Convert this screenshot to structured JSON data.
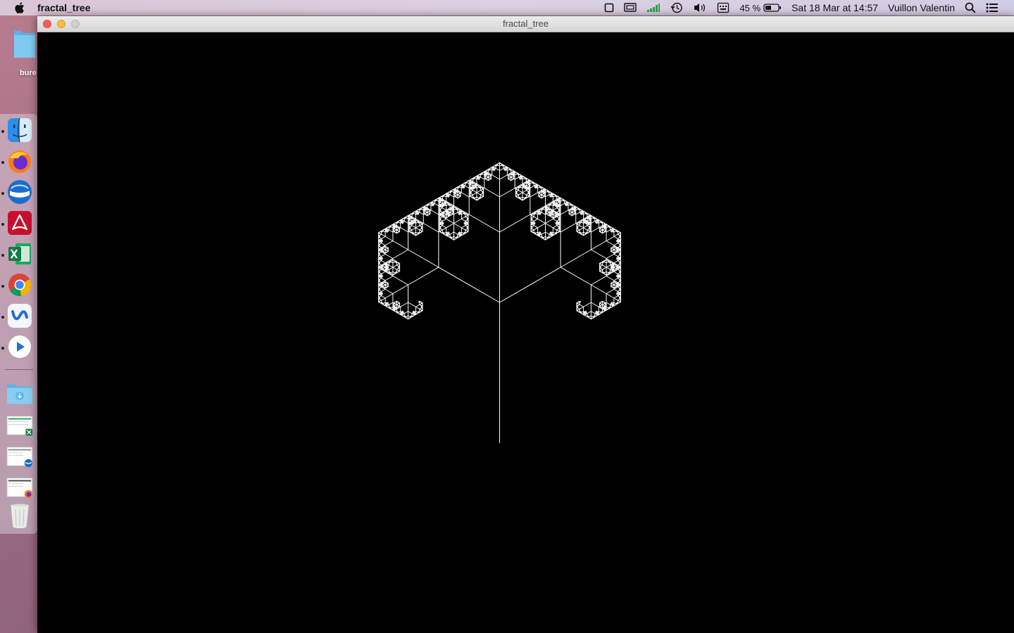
{
  "menubar": {
    "app_name": "fractal_tree",
    "battery_percent": "45 %",
    "datetime": "Sat 18 Mar at  14:57",
    "user": "Vuillon Valentin",
    "icons": [
      "apple-icon",
      "display-icon",
      "screen-mirroring-icon",
      "signal-bars-icon",
      "time-machine-icon",
      "volume-icon",
      "input-keyboard-icon",
      "battery-icon",
      "spotlight-search-icon",
      "notification-center-icon"
    ]
  },
  "desktop": {
    "folder_label": "bure"
  },
  "dock": {
    "apps": [
      "finder",
      "firefox",
      "thunderbird",
      "acrobat-reader",
      "excel",
      "chrome",
      "cisco-webex",
      "quicktime-player"
    ],
    "stack_items": [
      "downloads-folder",
      "excel-document",
      "thunderbird-document",
      "firefox-document",
      "trash"
    ]
  },
  "window": {
    "title": "fractal_tree"
  },
  "fractal": {
    "color": "#ffffff",
    "background": "#000000",
    "trunk_length": 200,
    "branch_angle_deg": 60,
    "scale_ratio": 0.5,
    "depth": 8
  },
  "colors": {
    "close": "#fc605b",
    "minimize": "#fdbc40",
    "maximize_disabled": "#cfcfcf"
  }
}
